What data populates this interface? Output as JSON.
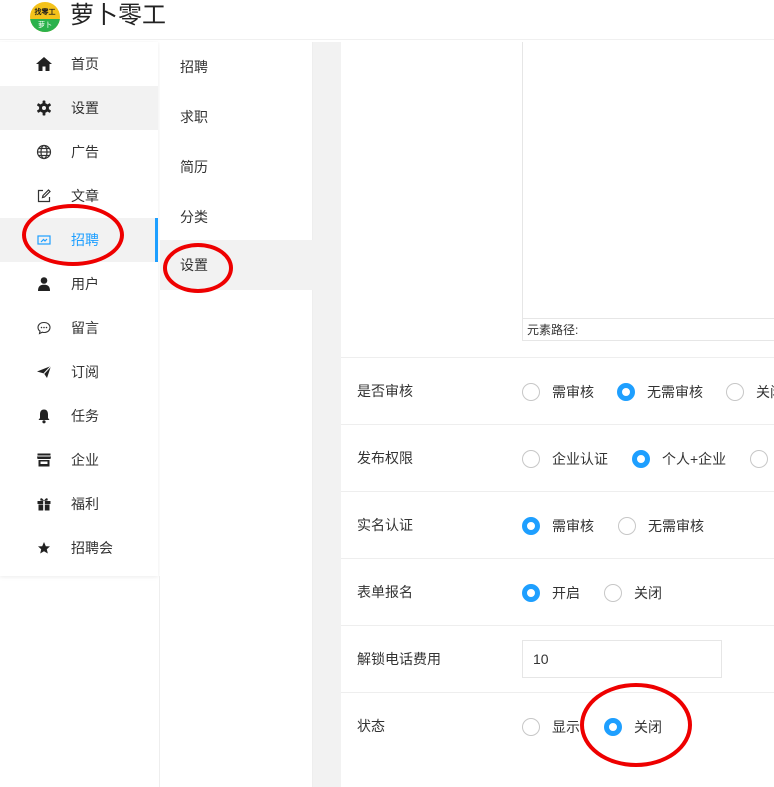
{
  "app": {
    "brand": "萝卜零工",
    "logo_top": "找零工",
    "logo_bottom": "萝卜"
  },
  "sidebar": {
    "items": [
      {
        "label": "首页",
        "icon": "home-icon"
      },
      {
        "label": "设置",
        "icon": "gear-icon"
      },
      {
        "label": "广告",
        "icon": "globe-icon"
      },
      {
        "label": "文章",
        "icon": "edit-icon"
      },
      {
        "label": "招聘",
        "icon": "recruit-icon"
      },
      {
        "label": "用户",
        "icon": "user-icon"
      },
      {
        "label": "留言",
        "icon": "message-icon"
      },
      {
        "label": "订阅",
        "icon": "send-icon"
      },
      {
        "label": "任务",
        "icon": "bell-icon"
      },
      {
        "label": "企业",
        "icon": "store-icon"
      },
      {
        "label": "福利",
        "icon": "gift-icon"
      },
      {
        "label": "招聘会",
        "icon": "star-icon"
      }
    ]
  },
  "subnav": {
    "items": [
      {
        "label": "招聘"
      },
      {
        "label": "求职"
      },
      {
        "label": "简历"
      },
      {
        "label": "分类"
      },
      {
        "label": "设置"
      }
    ]
  },
  "form": {
    "editor_path": "元素路径:",
    "audit": {
      "label": "是否审核",
      "options": [
        "需审核",
        "无需审核",
        "关闭"
      ],
      "selected": "无需审核"
    },
    "publish": {
      "label": "发布权限",
      "options": [
        "企业认证",
        "个人+企业"
      ],
      "selected": "个人+企业"
    },
    "realname": {
      "label": "实名认证",
      "options": [
        "需审核",
        "无需审核"
      ],
      "selected": "需审核"
    },
    "signup": {
      "label": "表单报名",
      "options": [
        "开启",
        "关闭"
      ],
      "selected": "开启"
    },
    "unlock_fee": {
      "label": "解锁电话费用",
      "value": "10"
    },
    "status": {
      "label": "状态",
      "options": [
        "显示",
        "关闭"
      ],
      "selected": "关闭"
    }
  },
  "colors": {
    "accent": "#1e9fff",
    "annotation": "#ee0000"
  }
}
